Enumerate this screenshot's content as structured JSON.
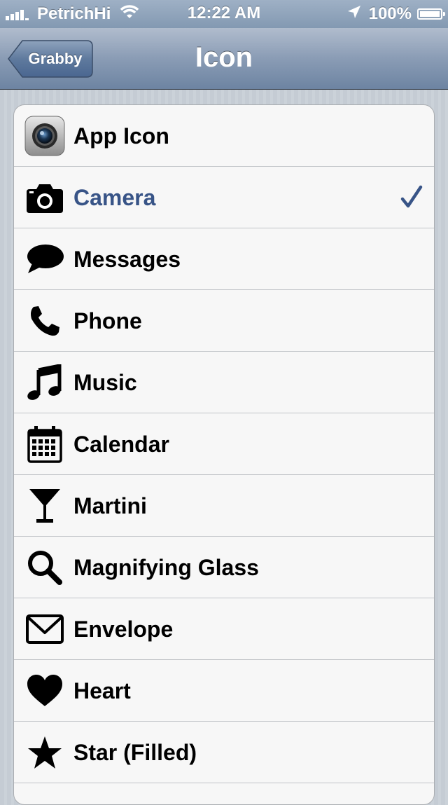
{
  "status_bar": {
    "carrier": "PetrichHi",
    "time": "12:22 AM",
    "battery": "100%"
  },
  "nav_bar": {
    "back_label": "Grabby",
    "title": "Icon"
  },
  "accent_color": "#385487",
  "items": [
    {
      "label": "App Icon",
      "icon": "app-camera-icon"
    },
    {
      "label": "Camera",
      "icon": "camera-icon",
      "selected": true
    },
    {
      "label": "Messages",
      "icon": "speech-bubble-icon"
    },
    {
      "label": "Phone",
      "icon": "phone-icon"
    },
    {
      "label": "Music",
      "icon": "music-note-icon"
    },
    {
      "label": "Calendar",
      "icon": "calendar-icon"
    },
    {
      "label": "Martini",
      "icon": "martini-glass-icon"
    },
    {
      "label": "Magnifying Glass",
      "icon": "magnifying-glass-icon"
    },
    {
      "label": "Envelope",
      "icon": "envelope-icon"
    },
    {
      "label": "Heart",
      "icon": "heart-icon"
    },
    {
      "label": "Star (Filled)",
      "icon": "star-icon"
    }
  ]
}
